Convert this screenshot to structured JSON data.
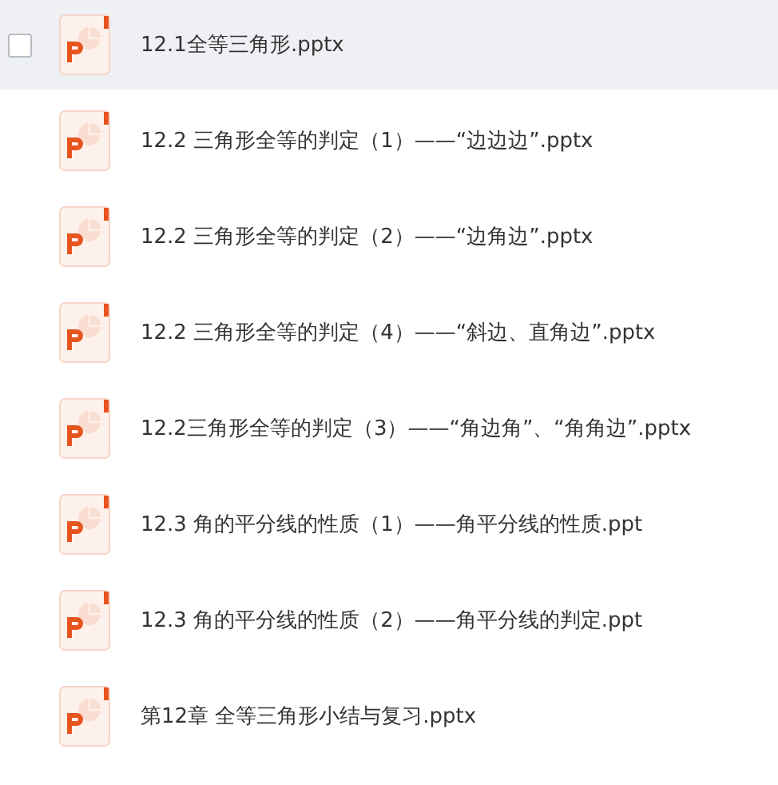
{
  "files": [
    {
      "name": "12.1全等三角形.pptx",
      "hovered": true,
      "checked": false
    },
    {
      "name": "12.2 三角形全等的判定（1）——“边边边”.pptx",
      "hovered": false,
      "checked": false
    },
    {
      "name": "12.2 三角形全等的判定（2）——“边角边”.pptx",
      "hovered": false,
      "checked": false
    },
    {
      "name": "12.2 三角形全等的判定（4）——“斜边、直角边”.pptx",
      "hovered": false,
      "checked": false
    },
    {
      "name": "12.2三角形全等的判定（3）——“角边角”、“角角边”.pptx",
      "hovered": false,
      "checked": false
    },
    {
      "name": "12.3 角的平分线的性质（1）——角平分线的性质.ppt",
      "hovered": false,
      "checked": false
    },
    {
      "name": "12.3 角的平分线的性质（2）——角平分线的判定.ppt",
      "hovered": false,
      "checked": false
    },
    {
      "name": "第12章 全等三角形小结与复习.pptx",
      "hovered": false,
      "checked": false
    }
  ]
}
